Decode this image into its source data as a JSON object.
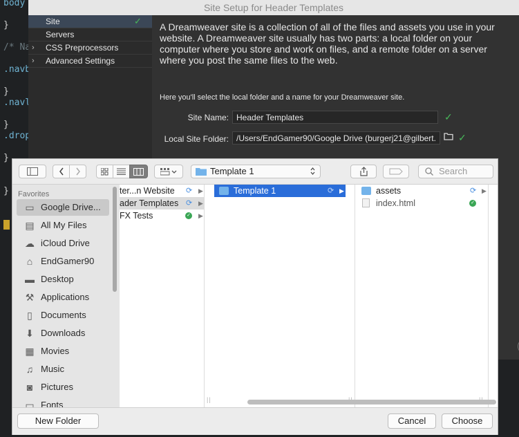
{
  "editor": {
    "lines": [
      {
        "text": "body",
        "cls": "kw-blue"
      },
      {
        "text": "}",
        "cls": "kw-white"
      },
      {
        "text": "/* Na",
        "cls": "kw-grey"
      },
      {
        "text": ".navb",
        "cls": "kw-blue"
      },
      {
        "text": "}",
        "cls": "kw-white"
      },
      {
        "text": ".navl",
        "cls": "kw-blue"
      },
      {
        "text": "}",
        "cls": "kw-white"
      },
      {
        "text": ".drop",
        "cls": "kw-blue"
      },
      {
        "text": "}",
        "cls": "kw-white"
      },
      {
        "text": "}",
        "cls": "kw-white"
      }
    ]
  },
  "setup": {
    "title": "Site Setup for Header Templates",
    "sidebar": [
      {
        "label": "Site",
        "selected": true,
        "check": "✓"
      },
      {
        "label": "Servers",
        "selected": false
      },
      {
        "label": "CSS Preprocessors",
        "selected": false,
        "chevron": "›"
      },
      {
        "label": "Advanced Settings",
        "selected": false,
        "chevron": "›"
      }
    ],
    "description": "A Dreamweaver site is a collection of all of the files and assets you use in your website. A Dreamweaver site usually has two parts: a local folder on your computer where you store and work on files, and a remote folder on a server where you post the same files to the web.",
    "hint": "Here you'll select the local folder and a name for your Dreamweaver site.",
    "site_name_label": "Site Name:",
    "site_name_value": "Header Templates",
    "local_folder_label": "Local Site Folder:",
    "local_folder_value": "/Users/EndGamer90/Google Drive (burgerj21@gilbert.",
    "check": "✓"
  },
  "chooser": {
    "toolbar": {
      "path_label": "Template 1",
      "search_placeholder": "Search"
    },
    "favorites_header": "Favorites",
    "favorites": [
      {
        "label": "Google Drive...",
        "icon": "folder-icon",
        "glyph": "▭",
        "selected": true
      },
      {
        "label": "All My Files",
        "icon": "all-files-icon",
        "glyph": "▤"
      },
      {
        "label": "iCloud Drive",
        "icon": "cloud-icon",
        "glyph": "☁"
      },
      {
        "label": "EndGamer90",
        "icon": "home-icon",
        "glyph": "⌂"
      },
      {
        "label": "Desktop",
        "icon": "desktop-icon",
        "glyph": "▬"
      },
      {
        "label": "Applications",
        "icon": "applications-icon",
        "glyph": "⚒"
      },
      {
        "label": "Documents",
        "icon": "documents-icon",
        "glyph": "▯"
      },
      {
        "label": "Downloads",
        "icon": "downloads-icon",
        "glyph": "⬇"
      },
      {
        "label": "Movies",
        "icon": "movies-icon",
        "glyph": "▦"
      },
      {
        "label": "Music",
        "icon": "music-icon",
        "glyph": "♫"
      },
      {
        "label": "Pictures",
        "icon": "pictures-icon",
        "glyph": "◙"
      },
      {
        "label": "Fonts",
        "icon": "fonts-icon",
        "glyph": "▭"
      }
    ],
    "col1": [
      {
        "label": "ter...n Website",
        "status": "syncing"
      },
      {
        "label": "ader Templates",
        "status": "syncing",
        "highlighted": true
      },
      {
        "label": "FX Tests",
        "status": "synced"
      }
    ],
    "col2": [
      {
        "label": "Template 1",
        "status": "syncing",
        "selected": true
      }
    ],
    "col3": [
      {
        "label": "assets",
        "type": "folder",
        "status": "syncing"
      },
      {
        "label": "index.html",
        "type": "file",
        "status": "synced"
      }
    ],
    "footer": {
      "new_folder": "New Folder",
      "cancel": "Cancel",
      "choose": "Choose"
    }
  }
}
